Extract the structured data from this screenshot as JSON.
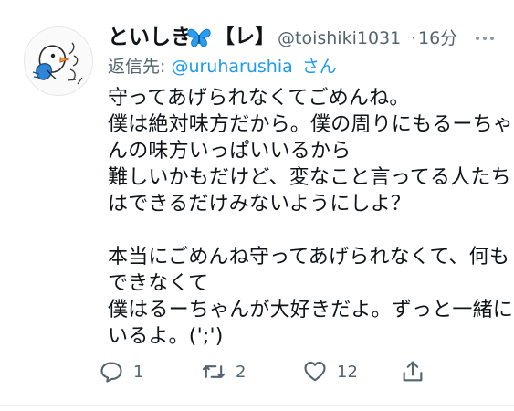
{
  "tweet": {
    "display_name": "といしき",
    "name_suffix": "【レ】",
    "handle": "@toishiki1031",
    "separator": "·",
    "time": "16分",
    "reply_prefix": "返信先:",
    "reply_user": "@uruharushia",
    "reply_suffix": "さん",
    "body_lines": [
      "守ってあげられなくてごめんね。",
      "僕は絶対味方だから。僕の周りにもるーちゃ",
      "んの味方いっぱいいるから",
      "難しいかもだけど、変なこと言ってる人たち",
      "はできるだけみないようにしよ？",
      "",
      "本当にごめんね守ってあげられなくて、何も",
      "できなくて",
      "僕はるーちゃんが大好きだよ。ずっと一緒に",
      "いるよ。(';')"
    ],
    "reply_count": "1",
    "retweet_count": "2",
    "like_count": "12"
  },
  "icons": {
    "avatar": "drawn-bird-avatar",
    "name_emoji": "blue-butterfly-icon",
    "more": "more-dots-icon",
    "reply": "reply-icon",
    "retweet": "retweet-icon",
    "like": "heart-icon",
    "share": "share-icon"
  },
  "colors": {
    "text": "#0f1419",
    "secondary": "#536471",
    "link": "#1d9bf0",
    "butterfly": "#2a9df4"
  }
}
